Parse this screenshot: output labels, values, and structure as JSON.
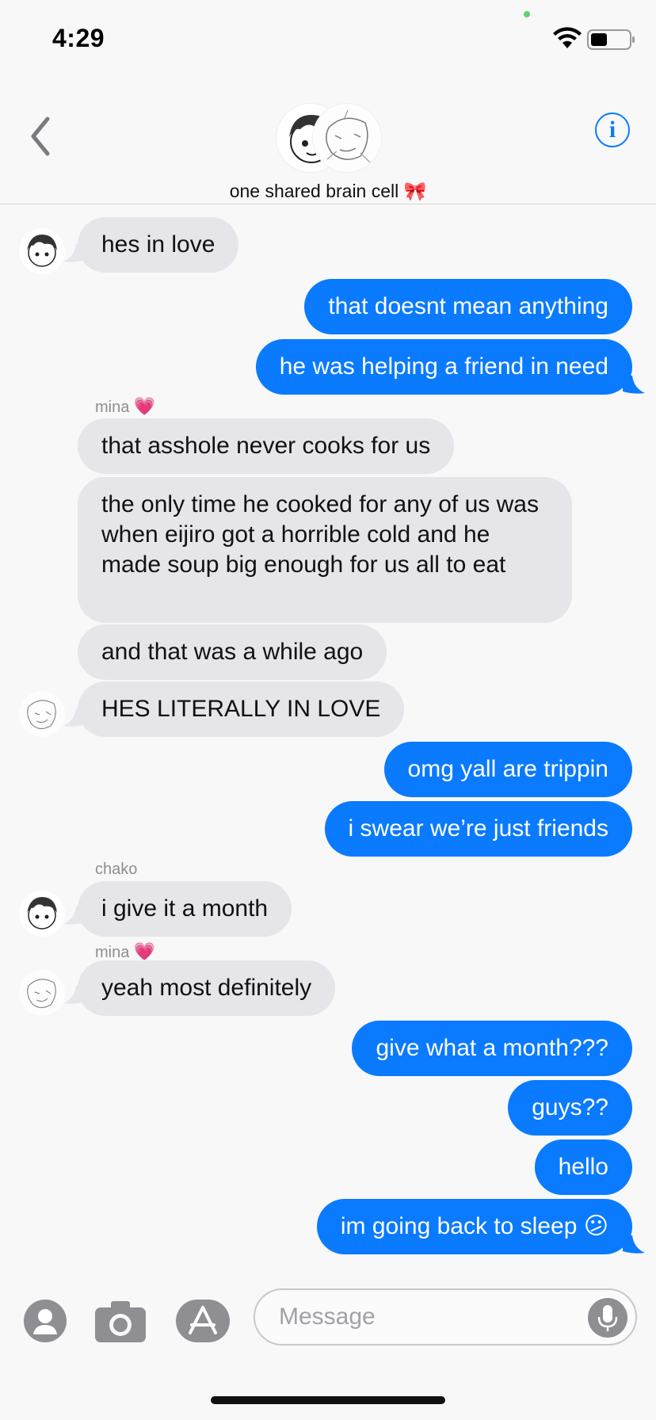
{
  "status_bar": {
    "time": "4:29",
    "icons": [
      "wifi-icon",
      "battery-icon"
    ]
  },
  "header": {
    "title": "one shared brain cell 🎀",
    "back_icon": "chevron-left-icon",
    "info_icon": "info-icon",
    "info_glyph": "i",
    "accent_color": "#0a7aff"
  },
  "messages": [
    {
      "type": "received",
      "text": "hes in love"
    },
    {
      "type": "sent",
      "text": "that doesnt mean anything"
    },
    {
      "type": "sent",
      "text": "he was helping a friend in need"
    },
    {
      "type": "sender",
      "name": "mina",
      "emoji": "💗"
    },
    {
      "type": "received",
      "text": "that asshole never cooks for us"
    },
    {
      "type": "received",
      "text": "the only time he cooked for any of us was when eijiro got a horrible cold and he made soup big enough for us all to eat"
    },
    {
      "type": "received",
      "text": "and that was a while ago"
    },
    {
      "type": "received",
      "text": "HES LITERALLY IN LOVE"
    },
    {
      "type": "sent",
      "text": "omg yall are trippin"
    },
    {
      "type": "sent",
      "text": "i swear we’re just friends"
    },
    {
      "type": "sender",
      "name": "chako"
    },
    {
      "type": "received",
      "text": "i give it a month"
    },
    {
      "type": "sender",
      "name": "mina",
      "emoji": "💗"
    },
    {
      "type": "received",
      "text": "yeah most definitely"
    },
    {
      "type": "sent",
      "text": "give what a month???"
    },
    {
      "type": "sent",
      "text": "guys??"
    },
    {
      "type": "sent",
      "text": "hello"
    },
    {
      "type": "sent",
      "text": "im going back to sleep 😕"
    }
  ],
  "input_bar": {
    "placeholder": "Message",
    "icons": [
      "contacts-icon",
      "camera-icon",
      "app-store-icon",
      "microphone-icon"
    ]
  },
  "colors": {
    "sent_bubble": "#0a7aff",
    "received_bubble": "#e6e5ea",
    "background": "#f8f8f8"
  }
}
